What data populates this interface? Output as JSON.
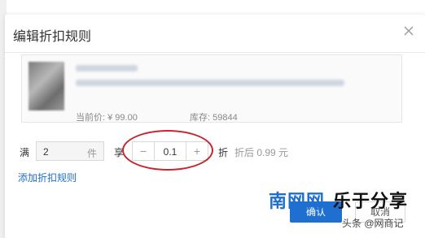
{
  "dialog": {
    "title": "编辑折扣规则"
  },
  "product": {
    "price_label": "当前价: ¥ 99.00",
    "stock_label": "库存: 59844"
  },
  "rule": {
    "prefix": "满",
    "quantity": "2",
    "unit": "件",
    "mid": "享",
    "discount": "0.1",
    "suffix": "折",
    "after_price": "折后 0.99 元"
  },
  "actions": {
    "add_rule": "添加折扣规则",
    "confirm": "确认",
    "cancel": "取消"
  },
  "watermark": {
    "logo_a": "南网网",
    "logo_b": "乐于分享",
    "sub": "头条 @网商记"
  },
  "colors": {
    "accent": "#1e6fcf",
    "annotation": "#c7262f"
  },
  "icons": {
    "close": "close-icon",
    "minus": "minus-icon",
    "plus": "plus-icon"
  }
}
